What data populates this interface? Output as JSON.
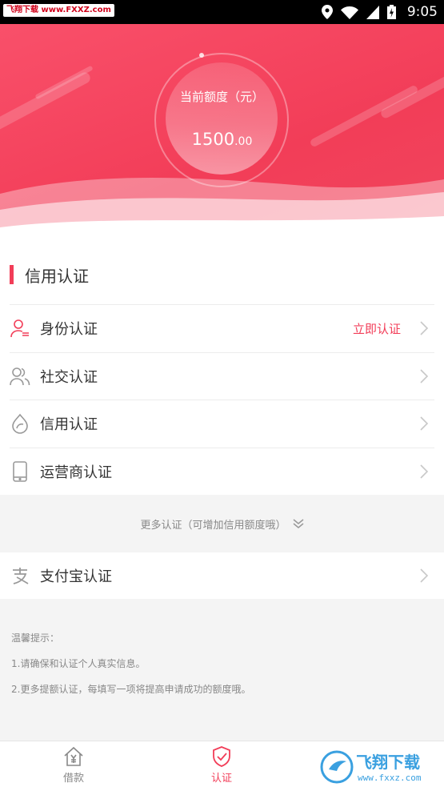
{
  "status_bar": {
    "watermark": "飞翔下载 www.FXXZ.com",
    "time": "9:05"
  },
  "hero": {
    "quota_label": "当前额度（元）",
    "quota_int": "1500",
    "quota_dec": ".00"
  },
  "credit_section": {
    "title": "信用认证",
    "items": [
      {
        "label": "身份认证",
        "action": "立即认证",
        "icon": "user-id-icon"
      },
      {
        "label": "社交认证",
        "action": "",
        "icon": "users-icon"
      },
      {
        "label": "信用认证",
        "action": "",
        "icon": "credit-icon"
      },
      {
        "label": "运营商认证",
        "action": "",
        "icon": "phone-icon"
      }
    ]
  },
  "more_auth": {
    "label": "更多认证（可增加信用额度哦）"
  },
  "alipay": {
    "label": "支付宝认证",
    "icon": "alipay-icon"
  },
  "tips": {
    "title": "温馨提示：",
    "lines": [
      "1.请确保和认证个人真实信息。",
      "2.更多提额认证，每填写一项将提高申请成功的额度哦。"
    ]
  },
  "tabbar": {
    "loan": "借款",
    "auth": "认证"
  },
  "corner_logo": {
    "text": "飞翔下载",
    "url": "www.fxxz.com"
  },
  "colors": {
    "accent": "#f23d58",
    "text": "#333333",
    "muted": "#888888"
  }
}
